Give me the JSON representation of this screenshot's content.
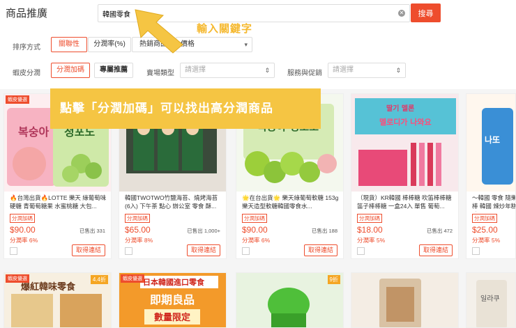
{
  "header": {
    "title": "商品推廣",
    "search_value": "韓國零食",
    "search_button": "搜尋"
  },
  "annotations": {
    "search_hint": "輸入關鍵字",
    "commission_hint": "點擊「分潤加碼」可以找出高分潤商品"
  },
  "filters": {
    "sort_label": "排序方式",
    "sort_options": [
      "關聯性",
      "分潤率(%)",
      "熱銷商品"
    ],
    "price_select": "價格",
    "shopee_label": "蝦皮分潤",
    "shopee_options": [
      "分潤加碼",
      "專屬推薦"
    ],
    "seller_type_label": "賣場類型",
    "seller_type_placeholder": "請選擇",
    "service_label": "服務與促銷",
    "service_placeholder": "請選擇"
  },
  "products": [
    {
      "badge": "蝦皮優選",
      "name": "🔥台灣出貨🔥LOTTE 樂天 綠葡萄味硬糖 青葡萄糖果 水蜜桃糖 大包...",
      "tag": "分潤加碼",
      "price": "$90.00",
      "sold": "已售出 331",
      "rate": "分潤率 6%",
      "action": "取得連結"
    },
    {
      "badge": "",
      "name": "韓國TWOTWO竹鹽海苔、燒烤海苔(6入) 下午茶 點心 辦公室 零食 酥...",
      "tag": "分潤加碼",
      "price": "$65.00",
      "sold": "已售出 1,000+",
      "rate": "分潤率 8%",
      "action": "取得連結"
    },
    {
      "badge": "",
      "name": "🌟在台出貨🌟 樂天綠葡萄軟糖 153g 樂天造型軟糖韓國零食水...",
      "tag": "分潤加碼",
      "price": "$90.00",
      "sold": "已售出 188",
      "rate": "分潤率 6%",
      "action": "取得連結"
    },
    {
      "badge": "",
      "name": "（現貨）KR韓國 棒棒糖 吹笛棒棒糖 笛子棒棒糖 一盒24入 單售 葡萄...",
      "tag": "分潤加碼",
      "price": "$18.00",
      "sold": "已售出 472",
      "rate": "分潤率 5%",
      "action": "取得連結"
    },
    {
      "badge": "",
      "name": "～韓國 零食 隨樂棒 韓國 辣炒年糕味",
      "tag": "分潤加碼",
      "price": "$25.00",
      "sold": "",
      "rate": "分潤率 5%",
      "action": ""
    }
  ],
  "products_row2": [
    {
      "badge": "蝦皮優選",
      "discount": "4.4折",
      "img_text": "爆紅韓味零食"
    },
    {
      "badge": "蝦皮優選",
      "discount": "",
      "img_text": "日本韓國進口零食 即期良品 數量限定"
    },
    {
      "badge": "",
      "discount": "9折",
      "img_text": ""
    },
    {
      "badge": "",
      "discount": "",
      "img_text": ""
    },
    {
      "badge": "",
      "discount": "",
      "img_text": ""
    }
  ],
  "colors": {
    "accent": "#ee4d2d",
    "annotation": "#f5c543"
  }
}
